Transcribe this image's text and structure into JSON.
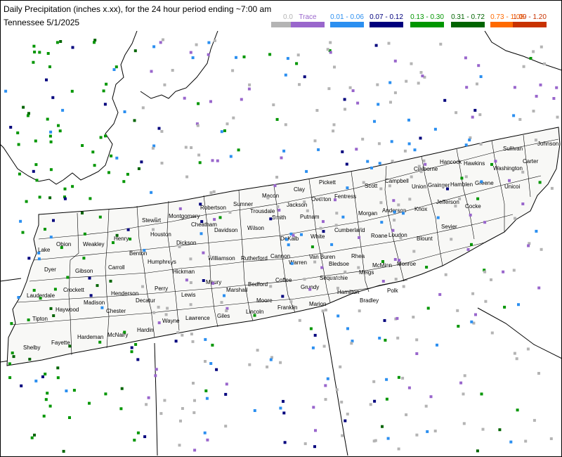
{
  "header": {
    "title": "Daily Precipitation (inches  x.xx),  for the 24 hour period ending ~7:00 am",
    "subtitle": "Tennessee 5/1/2025"
  },
  "legend": [
    {
      "label": "0.0",
      "color": "#b4b4b4"
    },
    {
      "label": "Trace",
      "color": "#9966cc"
    },
    {
      "label": "0.01 - 0.06",
      "color": "#2b8ff0"
    },
    {
      "label": "0.07 - 0.12",
      "color": "#00007d"
    },
    {
      "label": "0.13 - 0.30",
      "color": "#009600"
    },
    {
      "label": "0.31 - 0.72",
      "color": "#006400"
    },
    {
      "label": "0.73 - 1.08",
      "color": "#ff6a00"
    },
    {
      "label": "1.09 - 1.20",
      "color": "#c83200"
    }
  ],
  "map": {
    "background": "#ffffff",
    "state_fill": "#f8f8f6",
    "boundary_color": "#000000",
    "counties": [
      "Lake",
      "Obion",
      "Weakley",
      "Henry",
      "Stewart",
      "Montgomery",
      "Robertson",
      "Sumner",
      "Macon",
      "Clay",
      "Pickett",
      "Fentress",
      "Scott",
      "Campbell",
      "Claiborne",
      "Hancock",
      "Hawkins",
      "Sullivan",
      "Johnson",
      "Washington",
      "Carter",
      "Unicoi",
      "Greene",
      "Hamblen",
      "Grainger",
      "Union",
      "Jefferson",
      "Cocke",
      "Sevier",
      "Knox",
      "Blount",
      "Anderson",
      "Morgan",
      "Roane",
      "Loudon",
      "Monroe",
      "McMinn",
      "Meigs",
      "Rhea",
      "Cumberland",
      "Overton",
      "Putnam",
      "Jackson",
      "Smith",
      "Trousdale",
      "Wilson",
      "Davidson",
      "Cheatham",
      "Dickson",
      "Houston",
      "Benton",
      "Carroll",
      "Gibson",
      "Dyer",
      "Lauderdale",
      "Tipton",
      "Shelby",
      "Fayette",
      "Haywood",
      "Crockett",
      "Madison",
      "Chester",
      "Henderson",
      "Decatur",
      "Perry",
      "Humphreys",
      "Hickman",
      "Williamson",
      "Rutherford",
      "Cannon",
      "DeKalb",
      "White",
      "Van Buren",
      "Warren",
      "Bledsoe",
      "Sequatchie",
      "Hamilton",
      "Bradley",
      "Polk",
      "Marion",
      "Grundy",
      "Franklin",
      "Coffee",
      "Moore",
      "Lincoln",
      "Bedford",
      "Marshall",
      "Maury",
      "Giles",
      "Lawrence",
      "Wayne",
      "Hardin",
      "McNairy",
      "Hardeman",
      "Lewis"
    ]
  }
}
